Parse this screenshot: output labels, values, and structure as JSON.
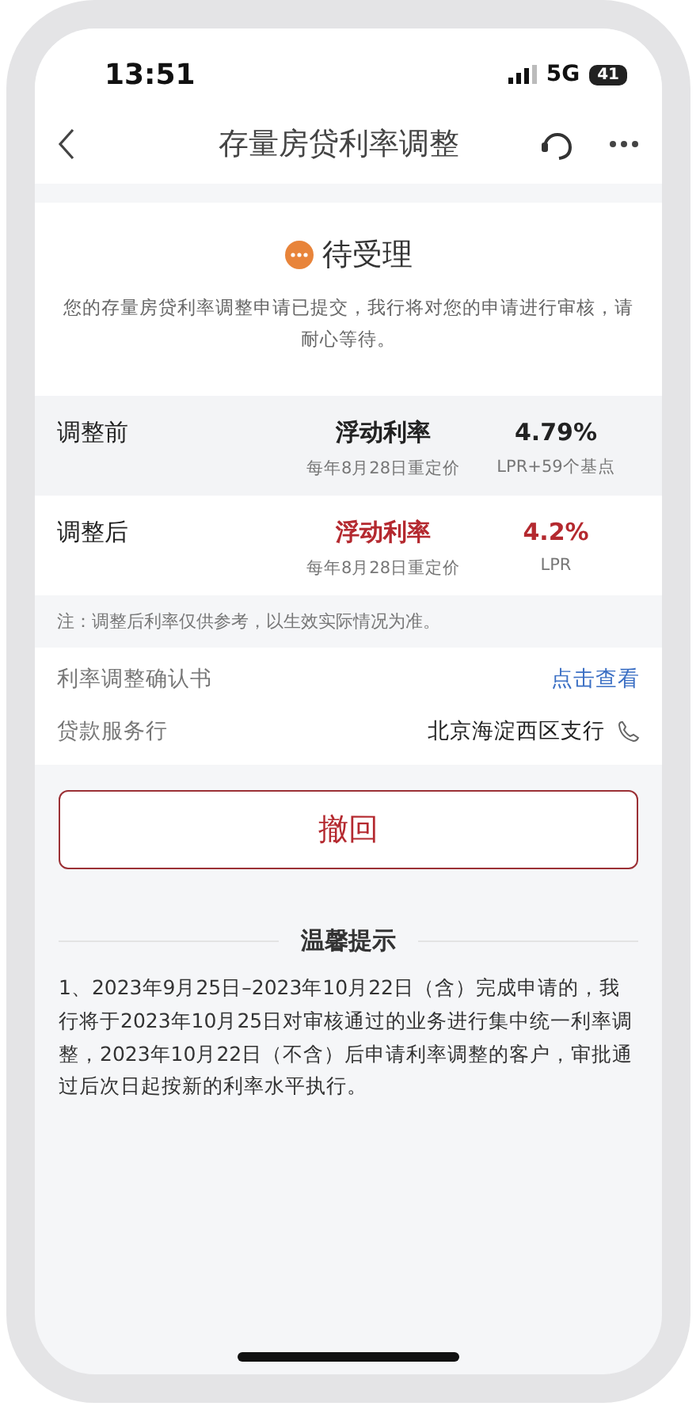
{
  "status_bar": {
    "time": "13:51",
    "network": "5G",
    "battery": "41"
  },
  "nav": {
    "title": "存量房贷利率调整"
  },
  "status": {
    "label": "待受理",
    "message": "您的存量房贷利率调整申请已提交，我行将对您的申请进行审核，请耐心等待。"
  },
  "rates": [
    {
      "label": "调整前",
      "rate_type": "浮动利率",
      "reprice": "每年8月28日重定价",
      "rate": "4.79%",
      "basis": "LPR+59个基点",
      "highlighted": false
    },
    {
      "label": "调整后",
      "rate_type": "浮动利率",
      "reprice": "每年8月28日重定价",
      "rate": "4.2%",
      "basis": "LPR",
      "highlighted": true
    }
  ],
  "note": "注：调整后利率仅供参考，以生效实际情况为准。",
  "details": [
    {
      "kind": "link",
      "label": "利率调整确认书",
      "value": "点击查看"
    },
    {
      "kind": "phone",
      "label": "贷款服务行",
      "value": "北京海淀西区支行"
    }
  ],
  "withdraw_button": "撤回",
  "tips": {
    "title": "温馨提示",
    "text": "1、2023年9月25日–2023年10月22日（含）完成申请的，我行将于2023年10月25日对审核通过的业务进行集中统一利率调整，2023年10月22日（不含）后申请利率调整的客户，审批通过后次日起按新的利率水平执行。"
  }
}
